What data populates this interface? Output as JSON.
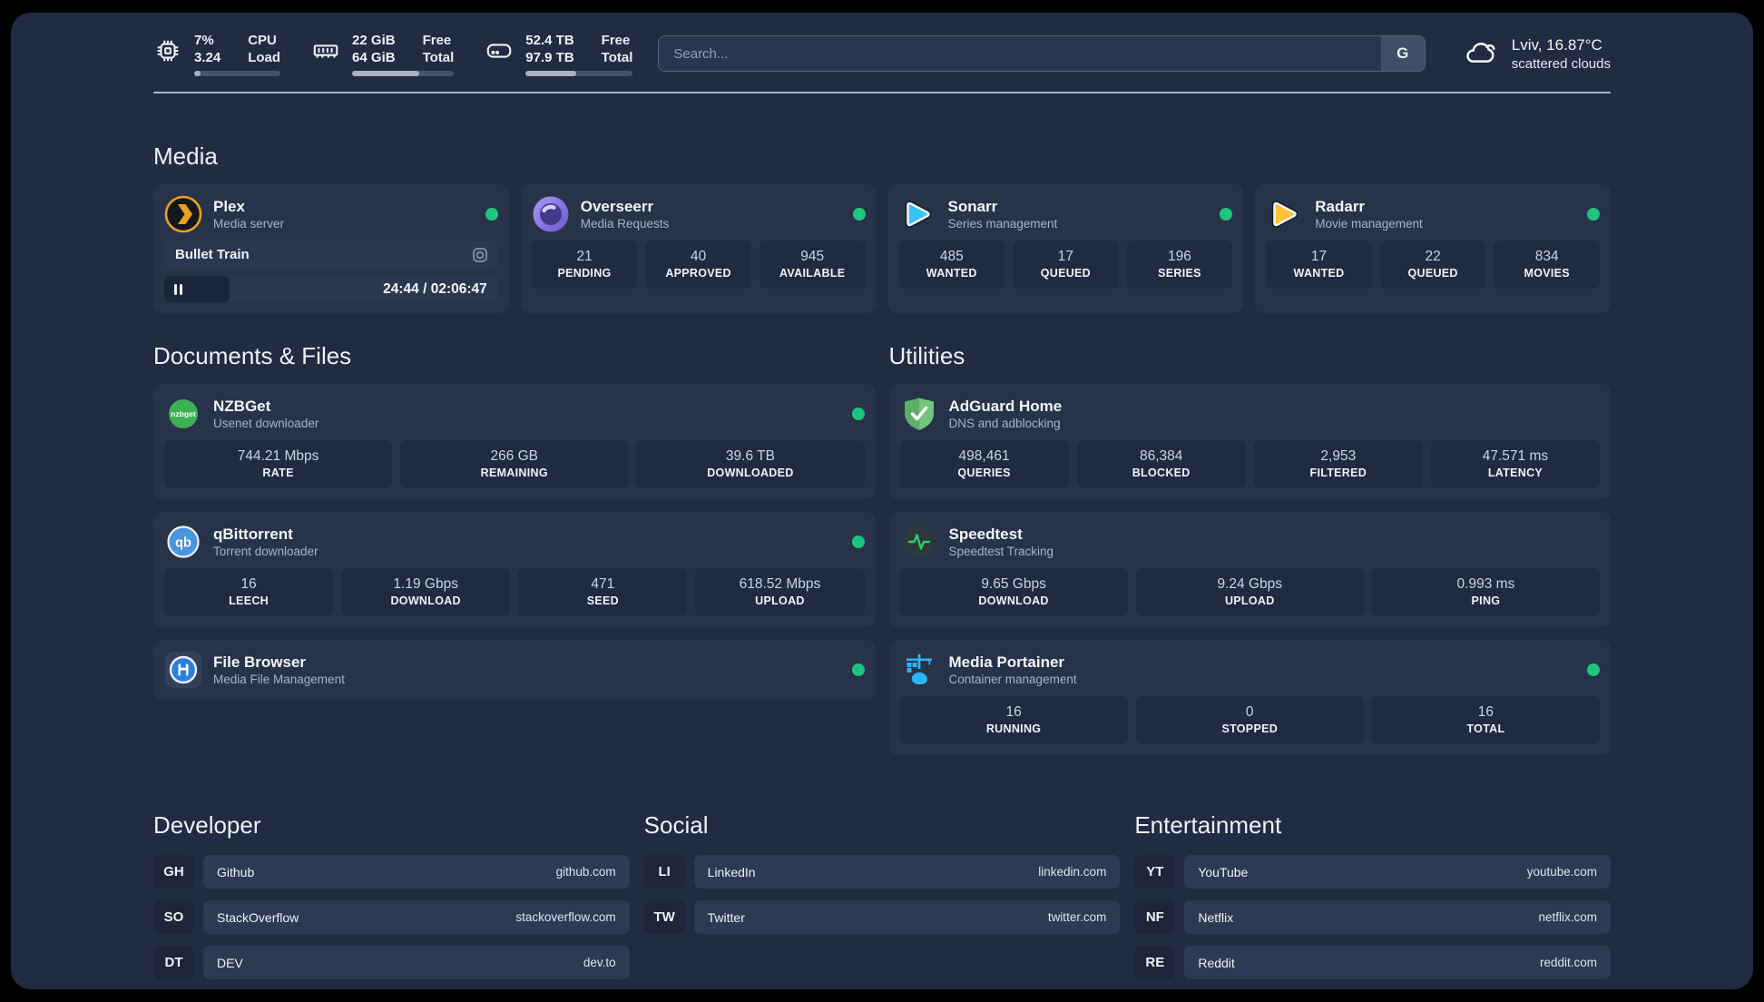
{
  "header": {
    "stats": [
      {
        "icon": "cpu-icon",
        "value_top": "7%",
        "value_bottom": "3.24",
        "label_top": "CPU",
        "label_bottom": "Load",
        "progress_percent": 7
      },
      {
        "icon": "ram-icon",
        "value_top": "22 GiB",
        "value_bottom": "64 GiB",
        "label_top": "Free",
        "label_bottom": "Total",
        "progress_percent": 66
      },
      {
        "icon": "disk-icon",
        "value_top": "52.4 TB",
        "value_bottom": "97.9 TB",
        "label_top": "Free",
        "label_bottom": "Total",
        "progress_percent": 47
      }
    ],
    "search": {
      "placeholder": "Search...",
      "button_label": "G"
    },
    "weather": {
      "icon": "cloud-icon",
      "location_temp": "Lviv, 16.87°C",
      "condition": "scattered clouds"
    }
  },
  "sections": {
    "media": {
      "title": "Media",
      "apps": [
        {
          "name": "Plex",
          "desc": "Media server",
          "icon": "plex-icon",
          "online": true,
          "now_playing": {
            "title": "Bullet Train",
            "time": "24:44 / 02:06:47",
            "progress_percent": 19.5
          }
        },
        {
          "name": "Overseerr",
          "desc": "Media Requests",
          "icon": "overseerr-icon",
          "online": true,
          "stats": [
            {
              "value": "21",
              "label": "PENDING"
            },
            {
              "value": "40",
              "label": "APPROVED"
            },
            {
              "value": "945",
              "label": "AVAILABLE"
            }
          ]
        },
        {
          "name": "Sonarr",
          "desc": "Series management",
          "icon": "sonarr-icon",
          "online": true,
          "stats": [
            {
              "value": "485",
              "label": "WANTED"
            },
            {
              "value": "17",
              "label": "QUEUED"
            },
            {
              "value": "196",
              "label": "SERIES"
            }
          ]
        },
        {
          "name": "Radarr",
          "desc": "Movie management",
          "icon": "radarr-icon",
          "online": true,
          "stats": [
            {
              "value": "17",
              "label": "WANTED"
            },
            {
              "value": "22",
              "label": "QUEUED"
            },
            {
              "value": "834",
              "label": "MOVIES"
            }
          ]
        }
      ]
    },
    "documents": {
      "title": "Documents & Files",
      "apps": [
        {
          "name": "NZBGet",
          "desc": "Usenet downloader",
          "icon": "nzbget-icon",
          "online": true,
          "stats": [
            {
              "value": "744.21 Mbps",
              "label": "RATE"
            },
            {
              "value": "266 GB",
              "label": "REMAINING"
            },
            {
              "value": "39.6 TB",
              "label": "DOWNLOADED"
            }
          ]
        },
        {
          "name": "qBittorrent",
          "desc": "Torrent downloader",
          "icon": "qbittorrent-icon",
          "online": true,
          "stats": [
            {
              "value": "16",
              "label": "LEECH"
            },
            {
              "value": "1.19 Gbps",
              "label": "DOWNLOAD"
            },
            {
              "value": "471",
              "label": "SEED"
            },
            {
              "value": "618.52 Mbps",
              "label": "UPLOAD"
            }
          ]
        },
        {
          "name": "File Browser",
          "desc": "Media File Management",
          "icon": "filebrowser-icon",
          "online": true,
          "stats": []
        }
      ]
    },
    "utilities": {
      "title": "Utilities",
      "apps": [
        {
          "name": "AdGuard Home",
          "desc": "DNS and adblocking",
          "icon": "adguard-icon",
          "online": false,
          "stats": [
            {
              "value": "498,461",
              "label": "QUERIES"
            },
            {
              "value": "86,384",
              "label": "BLOCKED"
            },
            {
              "value": "2,953",
              "label": "FILTERED"
            },
            {
              "value": "47.571 ms",
              "label": "LATENCY"
            }
          ]
        },
        {
          "name": "Speedtest",
          "desc": "Speedtest Tracking",
          "icon": "speedtest-icon",
          "online": false,
          "stats": [
            {
              "value": "9.65 Gbps",
              "label": "DOWNLOAD"
            },
            {
              "value": "9.24 Gbps",
              "label": "UPLOAD"
            },
            {
              "value": "0.993 ms",
              "label": "PING"
            }
          ]
        },
        {
          "name": "Media Portainer",
          "desc": "Container management",
          "icon": "portainer-icon",
          "online": true,
          "stats": [
            {
              "value": "16",
              "label": "RUNNING"
            },
            {
              "value": "0",
              "label": "STOPPED"
            },
            {
              "value": "16",
              "label": "TOTAL"
            }
          ]
        }
      ]
    },
    "links": [
      {
        "title": "Developer",
        "items": [
          {
            "abbr": "GH",
            "name": "Github",
            "url": "github.com"
          },
          {
            "abbr": "SO",
            "name": "StackOverflow",
            "url": "stackoverflow.com"
          },
          {
            "abbr": "DT",
            "name": "DEV",
            "url": "dev.to"
          }
        ]
      },
      {
        "title": "Social",
        "items": [
          {
            "abbr": "LI",
            "name": "LinkedIn",
            "url": "linkedin.com"
          },
          {
            "abbr": "TW",
            "name": "Twitter",
            "url": "twitter.com"
          }
        ]
      },
      {
        "title": "Entertainment",
        "items": [
          {
            "abbr": "YT",
            "name": "YouTube",
            "url": "youtube.com"
          },
          {
            "abbr": "NF",
            "name": "Netflix",
            "url": "netflix.com"
          },
          {
            "abbr": "RE",
            "name": "Reddit",
            "url": "reddit.com"
          }
        ]
      }
    ]
  },
  "colors": {
    "online_dot": "#1fc57d",
    "plex": "#e9a01c",
    "sonarr": "#35c5f4",
    "radarr": "#ffc230",
    "nzbget": "#3db054",
    "qbittorrent": "#4a95dd",
    "adguard": "#67b56f",
    "speedtest_pulse": "#2ecc71",
    "filebrowser": "#2f7ee0",
    "portainer": "#29b6f6",
    "overseerr": "#8f7bf1"
  }
}
